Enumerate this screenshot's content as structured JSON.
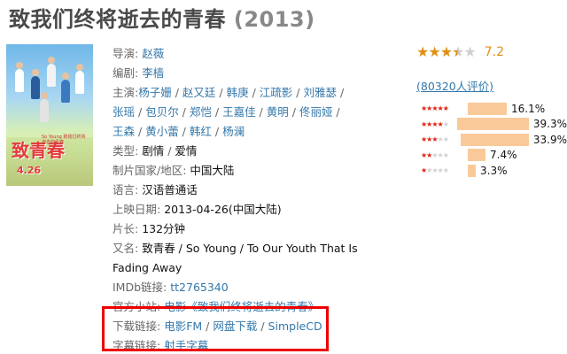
{
  "movie": {
    "title": "致我们终将逝去的青春",
    "year": "(2013)"
  },
  "poster": {
    "logo_text": "致青春",
    "date_text": "4.26",
    "small_text": "So Young 致我们终将逝去的青春"
  },
  "info": {
    "director_label": "导演:",
    "director": "赵薇",
    "writer_label": "编剧:",
    "writer": "李樯",
    "cast_label": "主演:",
    "cast": [
      "杨子姗",
      "赵又廷",
      "韩庚",
      "江疏影",
      "刘雅瑟",
      "张瑶",
      "包贝尔",
      "郑恺",
      "王嘉佳",
      "黄明",
      "佟丽娅",
      "王森",
      "黄小蕾",
      "韩红",
      "杨澜"
    ],
    "cast_sep": " / ",
    "genre_label": "类型:",
    "genres": [
      "剧情",
      "爱情"
    ],
    "country_label": "制片国家/地区:",
    "country": "中国大陆",
    "language_label": "语言:",
    "language": "汉语普通话",
    "release_label": "上映日期:",
    "release": "2013-04-26(中国大陆)",
    "runtime_label": "片长:",
    "runtime": "132分钟",
    "aka_label": "又名:",
    "aka_line1": "致青春 / So Young / To Our Youth That Is",
    "aka_line2": "Fading Away",
    "imdb_label": "IMDb链接:",
    "imdb": "tt2765340",
    "site_label": "官方小站:",
    "site": "电影《致我们终将逝去的青春》",
    "download_label": "下载链接:",
    "download_links": [
      "电影FM",
      "网盘下载",
      "SimpleCD"
    ],
    "subtitle_label": "字幕链接:",
    "subtitle_link": "射手字幕"
  },
  "rating": {
    "score": "7.2",
    "stars_value": 3.5,
    "votes_text": "(80320人评价)",
    "distribution": [
      {
        "stars": 5,
        "percent": 16.1,
        "label": "16.1%"
      },
      {
        "stars": 4,
        "percent": 39.3,
        "label": "39.3%"
      },
      {
        "stars": 3,
        "percent": 33.9,
        "label": "33.9%"
      },
      {
        "stars": 2,
        "percent": 7.4,
        "label": "7.4%"
      },
      {
        "stars": 1,
        "percent": 3.3,
        "label": "3.3%"
      }
    ],
    "star_color": "#e09015",
    "bar_color": "#f9c99a"
  }
}
